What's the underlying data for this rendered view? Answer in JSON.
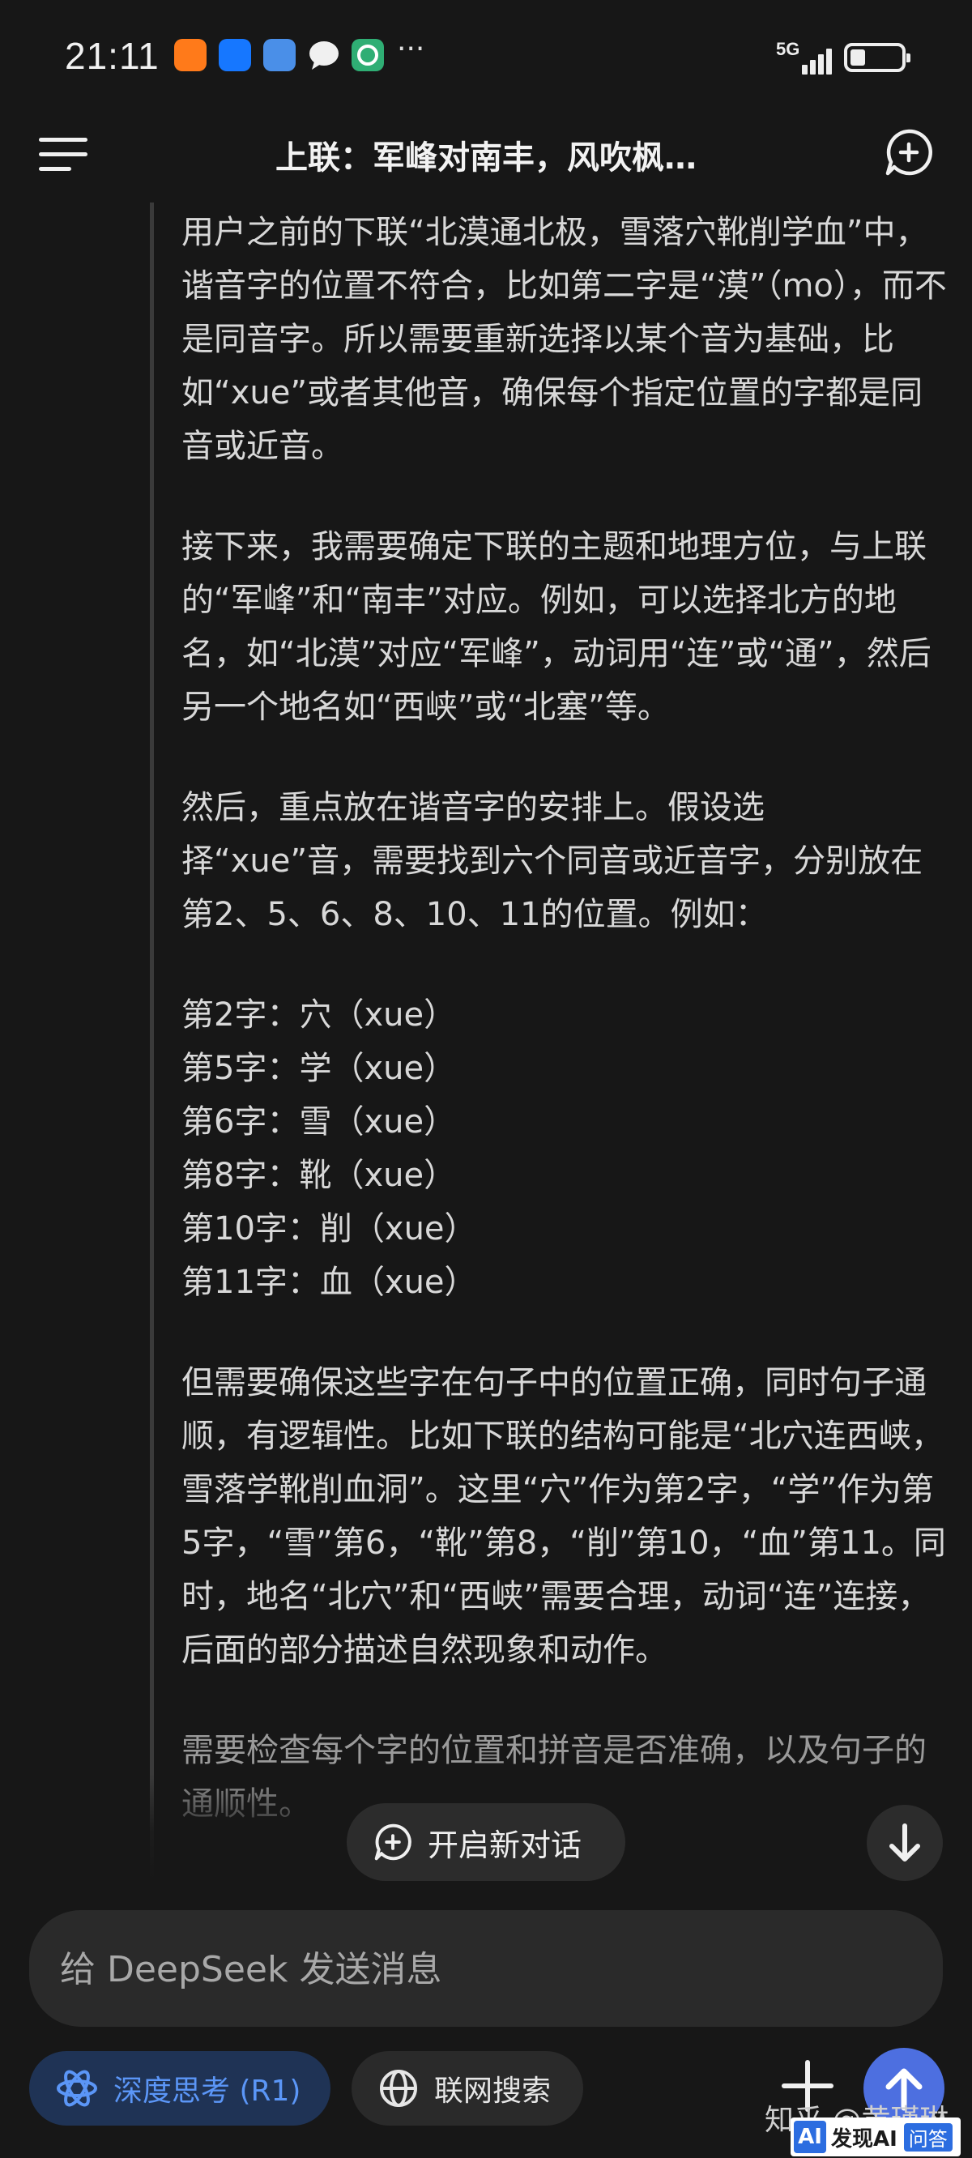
{
  "status_bar": {
    "time": "21:11",
    "network": "5G",
    "more_indicator": "···"
  },
  "header": {
    "title": "上联：军峰对南丰，风吹枫…"
  },
  "content": {
    "paragraphs": [
      "用户之前的下联“北漠通北极，雪落穴靴削学血”中，谐音字的位置不符合，比如第二字是“漠”（mo），而不是同音字。所以需要重新选择以某个音为基础，比如“xue”或者其他音，确保每个指定位置的字都是同音或近音。",
      "接下来，我需要确定下联的主题和地理方位，与上联的“军峰”和“南丰”对应。例如，可以选择北方的地名，如“北漠”对应“军峰”，动词用“连”或“通”，然后另一个地名如“西峡”或“北塞”等。",
      "然后，重点放在谐音字的安排上。假设选择“xue”音，需要找到六个同音或近音字，分别放在第2、5、6、8、10、11的位置。例如：",
      "但需要确保这些字在句子中的位置正确，同时句子通顺，有逻辑性。比如下联的结构可能是“北穴连西峡，雪落学靴削血洞”。这里“穴”作为第2字，“学”作为第5字，“雪”第6，“靴”第8，“削”第10，“血”第11。同时，地名“北穴”和“西峡”需要合理，动词“连”连接，后面的部分描述自然现象和动作。",
      "需要检查每个字的位置和拼音是否准确，以及句子的通顺性。"
    ],
    "list": [
      "第2字：穴（xue）",
      "第5字：学（xue）",
      "第6字：雪（xue）",
      "第8字：靴（xue）",
      "第10字：削（xue）",
      "第11字：血（xue）"
    ]
  },
  "floating": {
    "new_chat_label": "开启新对话"
  },
  "composer": {
    "placeholder": "给 DeepSeek 发送消息",
    "deep_think_label": "深度思考 (R1)",
    "web_search_label": "联网搜索"
  },
  "watermark": {
    "author": "知乎 @黄瑾琳",
    "site_badge_logo": "AI",
    "site_name": "发现AI",
    "site_tag": "问答"
  },
  "colors": {
    "background": "#171717",
    "accent_blue": "#4d6fe0",
    "deep_think_text": "#5b96f7"
  }
}
